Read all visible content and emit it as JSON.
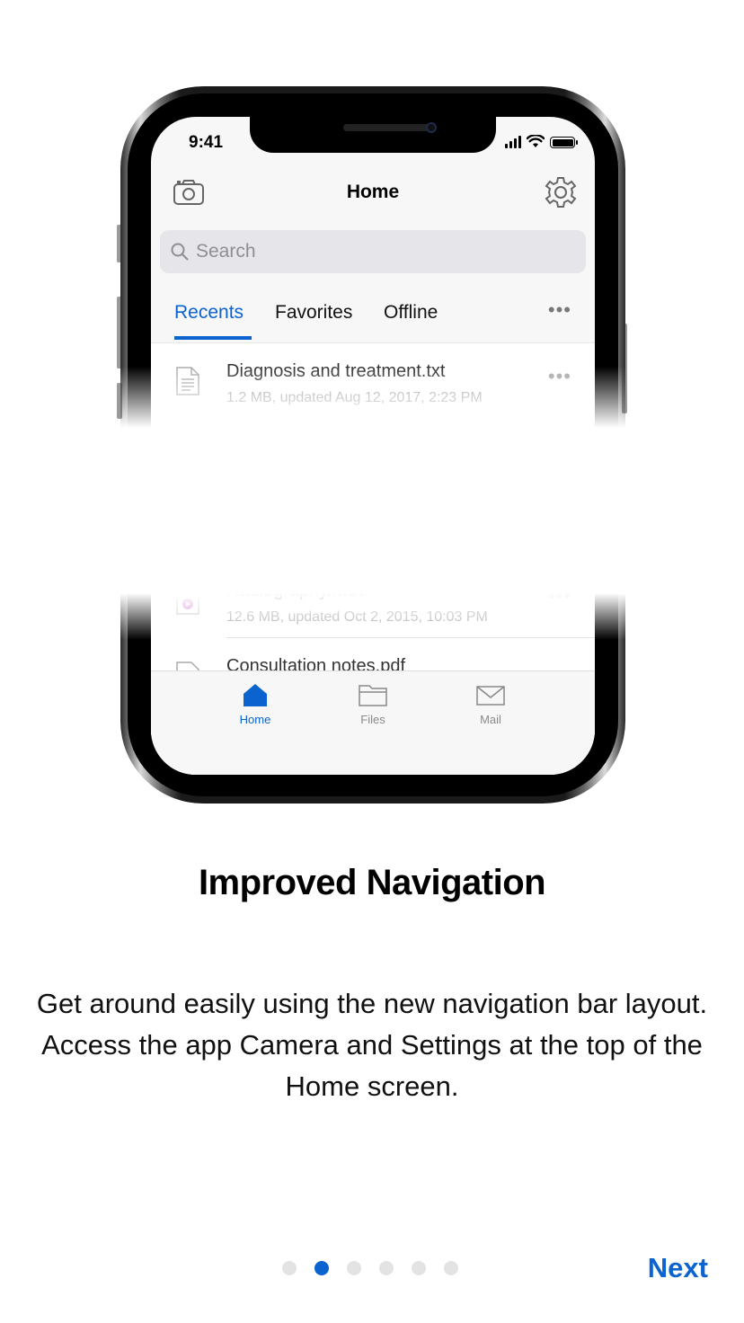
{
  "phone": {
    "status_time": "9:41",
    "nav_title": "Home",
    "search_placeholder": "Search",
    "tabs": [
      {
        "label": "Recents",
        "active": true
      },
      {
        "label": "Favorites",
        "active": false
      },
      {
        "label": "Offline",
        "active": false
      }
    ],
    "more_glyph": "•••",
    "files": [
      {
        "name": "Diagnosis and treatment.txt",
        "meta": "1.2 MB, updated Aug 12, 2017, 2:23 PM",
        "icon": "text-file-icon"
      },
      {
        "name": "Radiography.mov",
        "meta": "12.6 MB, updated Oct 2, 2015, 10:03 PM",
        "icon": "video-file-icon"
      },
      {
        "name": "Consultation notes.pdf",
        "meta": "",
        "icon": "pdf-file-icon"
      }
    ],
    "tab_bar": [
      {
        "label": "Home",
        "icon": "home-icon",
        "active": true
      },
      {
        "label": "Files",
        "icon": "folder-icon",
        "active": false
      },
      {
        "label": "Mail",
        "icon": "mail-icon",
        "active": false
      }
    ]
  },
  "onboarding": {
    "title": "Improved Navigation",
    "description": "Get around easily using the new navigation bar layout. Access the app Camera and Settings at the top of the Home screen.",
    "page_count": 6,
    "current_page": 2,
    "next_label": "Next"
  },
  "colors": {
    "accent": "#0a63cf",
    "dot_inactive": "#e3e3e3"
  }
}
